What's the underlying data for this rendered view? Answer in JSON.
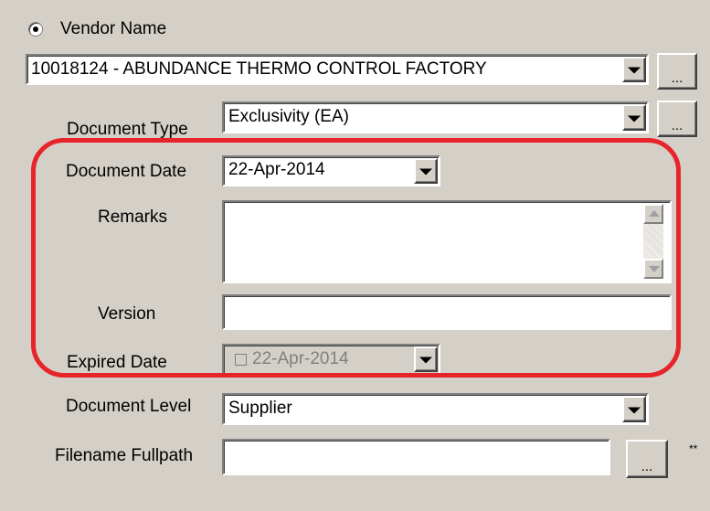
{
  "vendor": {
    "radio_label": "Vendor Name",
    "value": "10018124 - ABUNDANCE THERMO CONTROL FACTORY",
    "browse_label": "..."
  },
  "document_type": {
    "label": "Document Type",
    "value": "Exclusivity (EA)",
    "browse_label": "..."
  },
  "document_date": {
    "label": "Document Date",
    "value": "22-Apr-2014"
  },
  "remarks": {
    "label": "Remarks",
    "value": ""
  },
  "version": {
    "label": "Version",
    "value": ""
  },
  "expired_date": {
    "label": "Expired Date",
    "value": "22-Apr-2014",
    "checked": false
  },
  "document_level": {
    "label": "Document Level",
    "value": "Supplier"
  },
  "filename": {
    "label": "Filename Fullpath",
    "value": "",
    "browse_label": "...",
    "required_mark": "**"
  },
  "colors": {
    "panel_bg": "#d4d0c8",
    "highlight": "#e8242b"
  }
}
